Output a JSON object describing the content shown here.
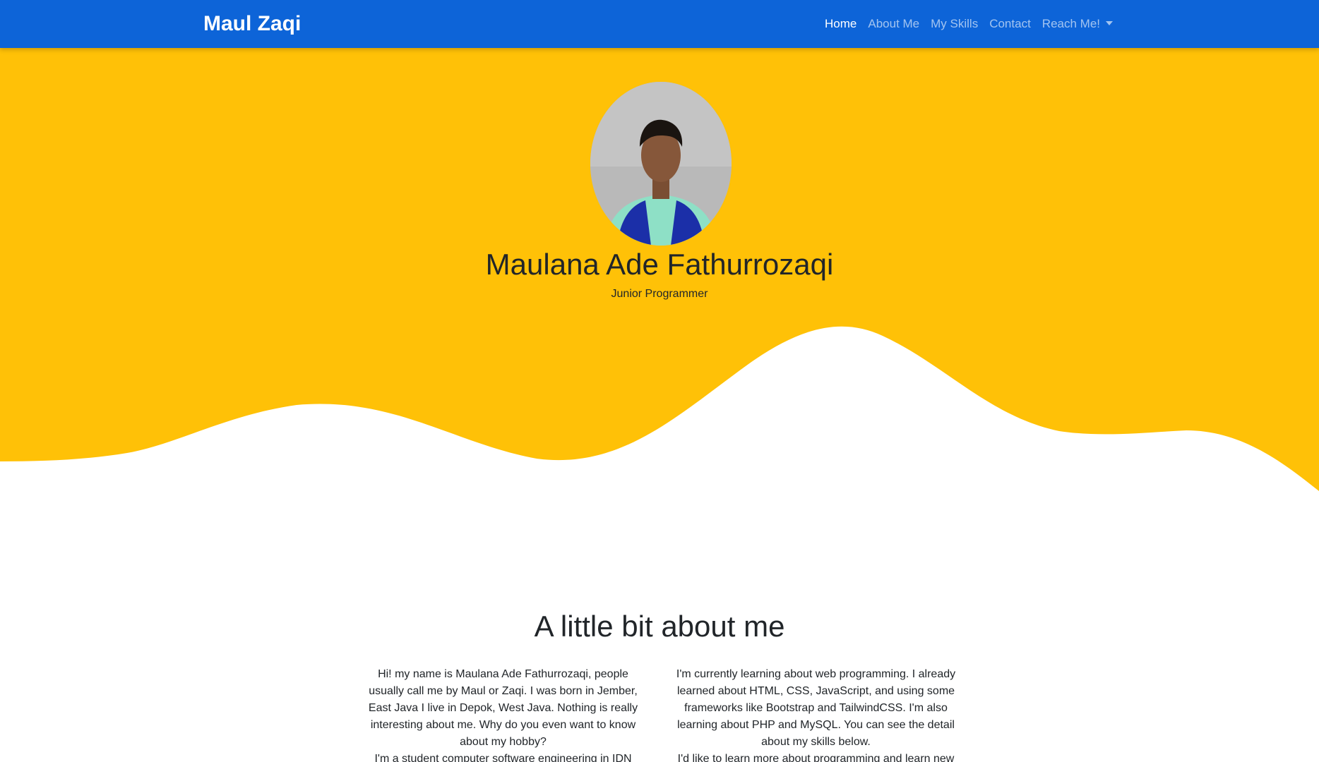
{
  "navbar": {
    "brand": "Maul Zaqi",
    "links": [
      {
        "label": "Home",
        "active": true
      },
      {
        "label": "About Me",
        "active": false
      },
      {
        "label": "My Skills",
        "active": false
      },
      {
        "label": "Contact",
        "active": false
      },
      {
        "label": "Reach Me!",
        "active": false,
        "dropdown": true
      }
    ]
  },
  "hero": {
    "name": "Maulana Ade Fathurrozaqi",
    "role": "Junior Programmer",
    "colors": {
      "background": "#ffc107",
      "wave": "#ffffff"
    }
  },
  "about": {
    "title": "A little bit about me",
    "column_left": {
      "p1": "Hi! my name is Maulana Ade Fathurrozaqi, people usually call me by Maul or Zaqi. I was born in Jember, East Java I live in Depok, West Java. Nothing is really interesting about me. Why do you even want to know about my hobby?",
      "p2": "I'm a student computer software engineering in IDN"
    },
    "column_right": {
      "p1": "I'm currently learning about web programming. I already learned about HTML, CSS, JavaScript, and using some frameworks like Bootstrap and TailwindCSS. I'm also learning about PHP and MySQL. You can see the detail about my skills below.",
      "p2": "I'd like to learn more about programming and learn new"
    }
  },
  "colors": {
    "navbar": "#0d64d8",
    "text": "#212529"
  }
}
